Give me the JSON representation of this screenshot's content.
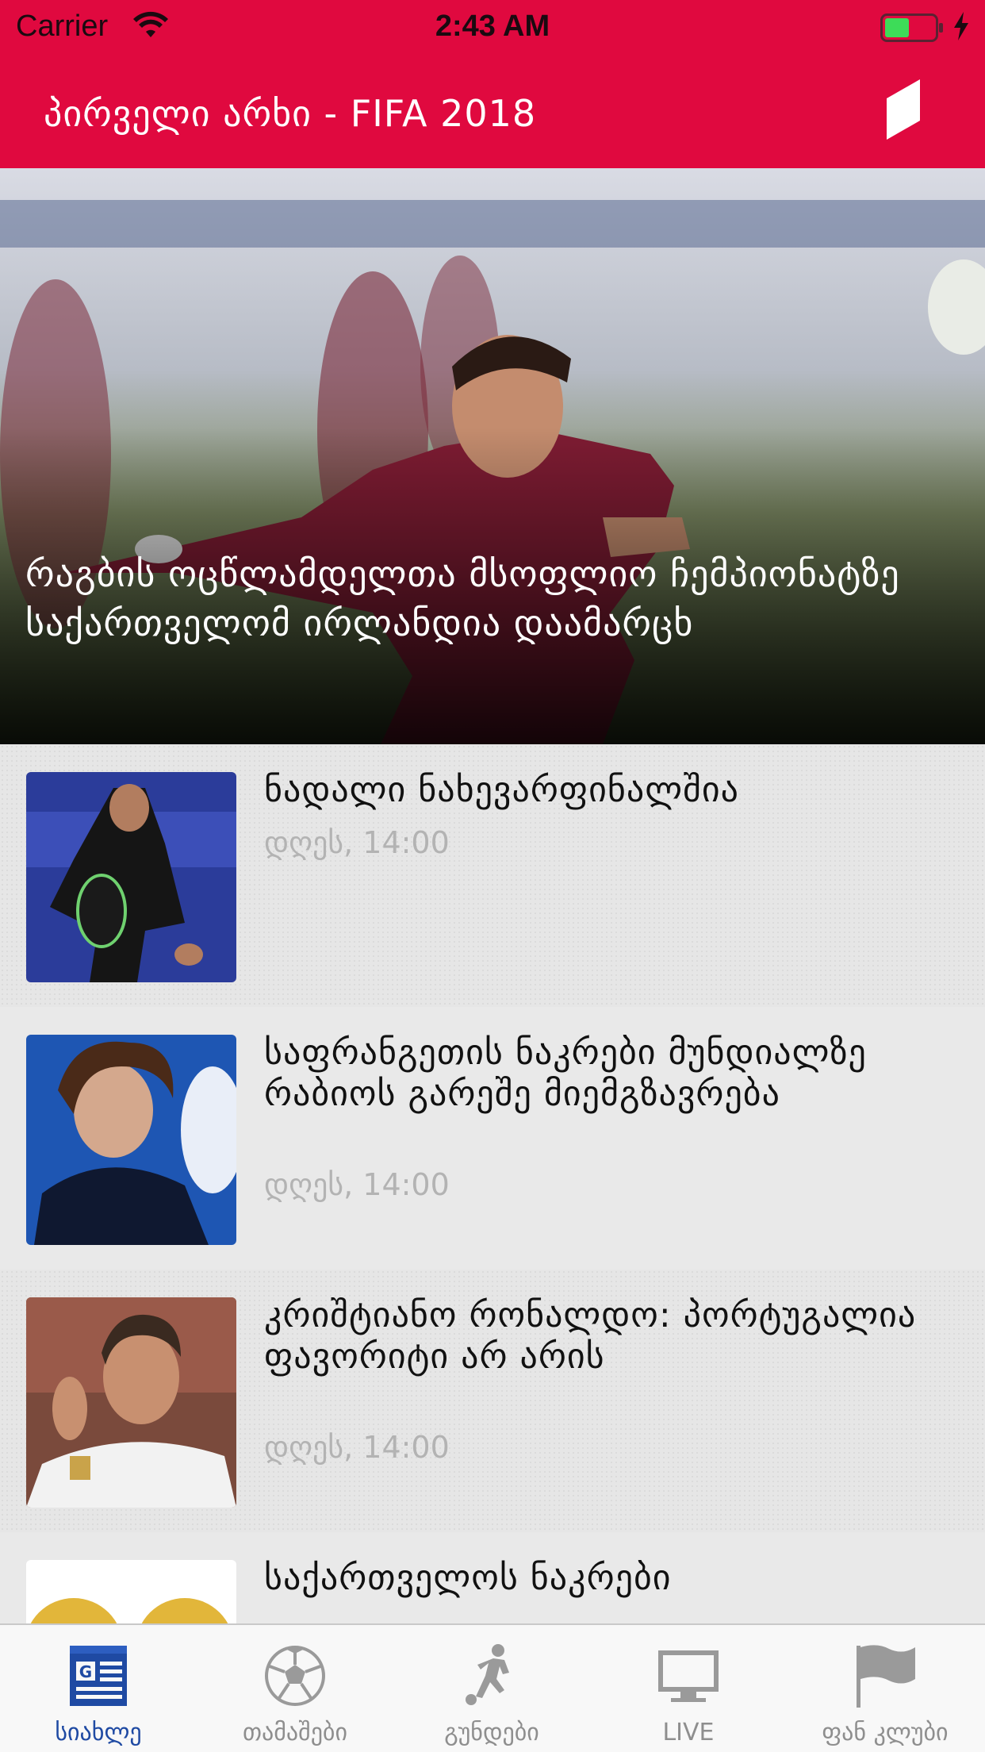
{
  "status_bar": {
    "carrier": "Carrier",
    "time": "2:43 AM"
  },
  "nav": {
    "title": "პირველი არხი - FIFA 2018",
    "logo_icon": "channel-one-logo"
  },
  "hero": {
    "title": "რაგბის ოცწლამდელთა მსოფლიო ჩემპიონატზე საქართველომ ირლანდია დაამარცხ"
  },
  "news": [
    {
      "title": "ნადალი ნახევარფინალშია",
      "time": "დღეს, 14:00",
      "thumb": "tennis-player"
    },
    {
      "title": "საფრანგეთის ნაკრები მუნდიალზე რაბიოს გარეშე მიემგზავრება",
      "time": "დღეს, 14:00",
      "thumb": "footballer-france"
    },
    {
      "title": "კრიშტიანო რონალდო: პორტუგალია ფავორიტი არ არის",
      "time": "დღეს, 14:00",
      "thumb": "footballer-ronaldo"
    },
    {
      "title": "საქართველოს ნაკრები",
      "time": "",
      "thumb": "golden-balls"
    }
  ],
  "tabs": [
    {
      "label": "სიახლე",
      "icon": "newspaper-icon",
      "active": true
    },
    {
      "label": "თამაშები",
      "icon": "soccer-ball-icon",
      "active": false
    },
    {
      "label": "გუნდები",
      "icon": "player-kick-icon",
      "active": false
    },
    {
      "label": "LIVE",
      "icon": "tv-icon",
      "active": false
    },
    {
      "label": "ფან კლუბი",
      "icon": "flag-icon",
      "active": false
    }
  ],
  "colors": {
    "brand": "#e0093f",
    "tab_active": "#1f4aa3",
    "tab_inactive": "#8e8e8e",
    "time_text": "#b3b3b3"
  }
}
